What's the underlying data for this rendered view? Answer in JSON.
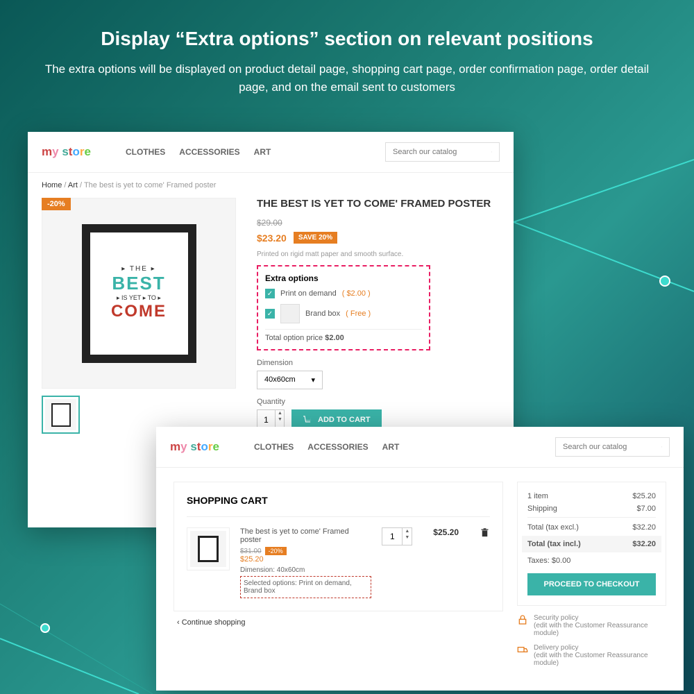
{
  "header": {
    "title": "Display “Extra options” section on relevant positions",
    "subtitle": "The extra options will be displayed on product detail page, shopping cart page, order confirmation page, order detail page, and on the email sent to customers"
  },
  "logo": "my store",
  "nav": {
    "clothes": "CLOTHES",
    "accessories": "ACCESSORIES",
    "art": "ART"
  },
  "search": {
    "placeholder": "Search our catalog"
  },
  "breadcrumb": {
    "home": "Home",
    "art": "Art",
    "current": "The best is yet to come' Framed poster"
  },
  "product": {
    "discount_badge": "-20%",
    "title": "THE BEST IS YET TO COME' FRAMED POSTER",
    "old_price": "$29.00",
    "new_price": "$23.20",
    "save": "SAVE 20%",
    "desc": "Printed on rigid matt paper and smooth surface.",
    "poster": {
      "the": "▸ THE ▸",
      "best": "BEST",
      "isyet": "▸ IS YET ▸ TO ▸",
      "come": "COME"
    }
  },
  "extra": {
    "title": "Extra options",
    "opt1_label": "Print on demand",
    "opt1_price": "( $2.00 )",
    "opt2_label": "Brand box",
    "opt2_price": "( Free )",
    "total_label": "Total option price ",
    "total_value": "$2.00"
  },
  "dimension": {
    "label": "Dimension",
    "value": "40x60cm"
  },
  "quantity": {
    "label": "Quantity",
    "value": "1"
  },
  "add_to_cart": "ADD TO CART",
  "cart": {
    "title": "SHOPPING CART",
    "item_name": "The best is yet to come' Framed poster",
    "old_price": "$31.00",
    "discount": "-20%",
    "new_price": "$25.20",
    "dimension": "Dimension: 40x60cm",
    "selected": "Selected options: Print on demand, Brand box",
    "qty": "1",
    "line_price": "$25.20",
    "continue": "Continue shopping"
  },
  "summary": {
    "items_label": "1 item",
    "items_val": "$25.20",
    "ship_label": "Shipping",
    "ship_val": "$7.00",
    "excl_label": "Total (tax excl.)",
    "excl_val": "$32.20",
    "incl_label": "Total (tax incl.)",
    "incl_val": "$32.20",
    "taxes": "Taxes: $0.00",
    "checkout": "PROCEED TO CHECKOUT"
  },
  "policies": {
    "sec_title": "Security policy",
    "sec_sub": "(edit with the Customer Reassurance module)",
    "del_title": "Delivery policy",
    "del_sub": "(edit with the Customer Reassurance module)"
  }
}
